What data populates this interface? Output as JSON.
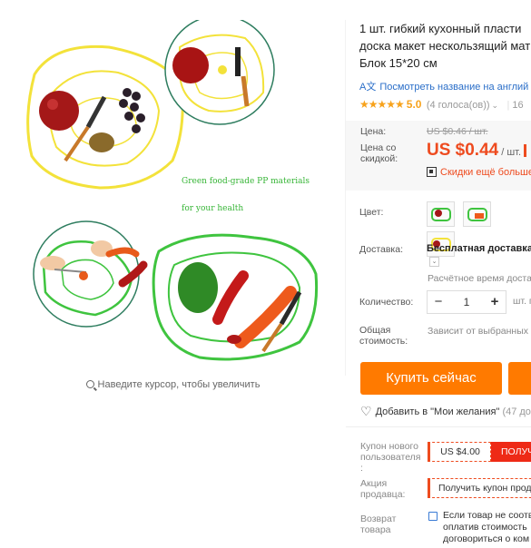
{
  "product": {
    "title_lines": [
      "1 шт. гибкий кухонный пласти",
      "доска макет нескользящий мат",
      "Блок 15*20 см"
    ],
    "translate_link": "Посмотреть название на англий",
    "rating_stars": "★★★★★",
    "rating_value": "5.0",
    "votes": "(4 голоса(ов))",
    "orders": "16"
  },
  "image": {
    "caption_1": "Green food-grade PP materials",
    "caption_2": "for your health",
    "zoom_hint": "Наведите курсор, чтобы увеличить"
  },
  "price": {
    "old_label": "Цена:",
    "old_value": "US $0.46 / шт.",
    "new_label": "Цена со скидкой:",
    "new_value": "US $0.44",
    "per_unit": "/ шт.",
    "discount_link": "Скидки ещё больше"
  },
  "attributes": {
    "color_label": "Цвет:",
    "swatches": [
      "swatch-1",
      "swatch-2",
      "swatch-3"
    ],
    "shipping_label": "Доставка:",
    "shipping_value": "Бесплатная доставка",
    "shipping_toggle": "⌄",
    "shipping_time": "Расчётное время доста",
    "quantity_label": "Количество:",
    "quantity_value": "1",
    "quantity_minus": "−",
    "quantity_plus": "+",
    "quantity_unit": "шт. п",
    "total_label": "Общая стоимость:",
    "total_value": "Зависит от выбранных"
  },
  "actions": {
    "buy_now": "Купить сейчас",
    "wishlist": "Добавить в \"Мои желания\"",
    "wishlist_count": "(47 до"
  },
  "coupons": {
    "new_user_label": "Купон нового пользователя :",
    "new_user_amount": "US $4.00",
    "new_user_get": "ПОЛУЧ",
    "seller_label": "Акция продавца:",
    "seller_coupon": "Получить купон прод",
    "return_label": "Возврат товара",
    "return_text_lines": [
      "Если товар не соотв",
      "оплатив стоимость",
      "договориться о ком"
    ]
  },
  "colors": {
    "accent": "#ff7a00",
    "price_red": "#ee4b1f",
    "rating": "#f7a21b",
    "link_blue": "#2a6ec8"
  }
}
